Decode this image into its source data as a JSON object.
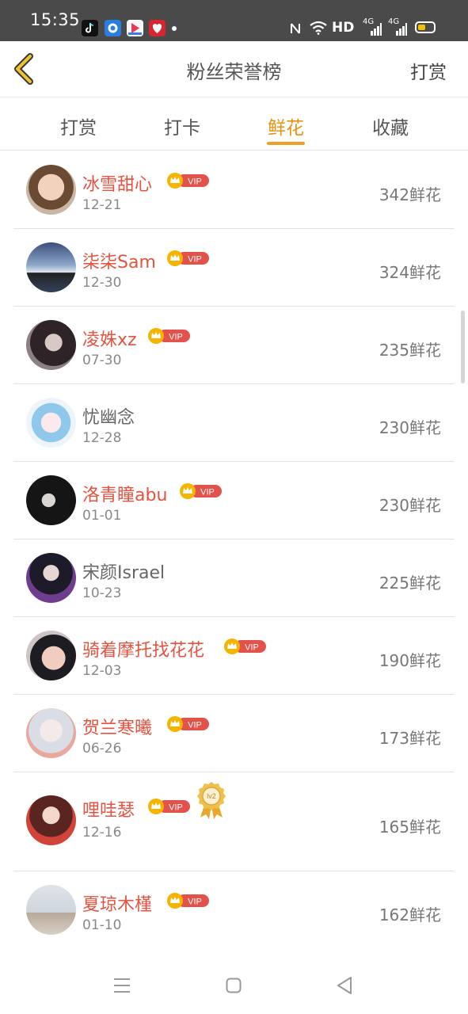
{
  "status_bar": {
    "time": "15:35",
    "network_label": "HD",
    "signal1": "4G",
    "signal2": "4G",
    "apps": [
      {
        "icon": "tiktok-icon",
        "color": "#111111"
      },
      {
        "icon": "browser-icon",
        "color": "#2a7de1"
      },
      {
        "icon": "video-app-icon",
        "color": "#e33b5a"
      },
      {
        "icon": "heart-app-icon",
        "color": "#d8262e"
      }
    ]
  },
  "header": {
    "title": "粉丝荣誉榜",
    "action": "打赏"
  },
  "tabs": [
    {
      "label": "打赏",
      "active": false
    },
    {
      "label": "打卡",
      "active": false
    },
    {
      "label": "鲜花",
      "active": true
    },
    {
      "label": "收藏",
      "active": false
    }
  ],
  "vip_text": "VIP",
  "level_badge_text": "lv2",
  "fans": [
    {
      "name": "冰雪甜心",
      "date": "12-21",
      "count": "342鲜花",
      "vip": true
    },
    {
      "name": "柒柒Sam",
      "date": "12-30",
      "count": "324鲜花",
      "vip": true
    },
    {
      "name": "凌姝xz",
      "date": "07-30",
      "count": "235鲜花",
      "vip": true
    },
    {
      "name": "忧幽念",
      "date": "12-28",
      "count": "230鲜花",
      "vip": false
    },
    {
      "name": "洛青瞳abu",
      "date": "01-01",
      "count": "230鲜花",
      "vip": true
    },
    {
      "name": "宋颜Israel",
      "date": "10-23",
      "count": "225鲜花",
      "vip": false
    },
    {
      "name": "骑着摩托找花花",
      "date": "12-03",
      "count": "190鲜花",
      "vip": true
    },
    {
      "name": "贺兰寒曦",
      "date": "06-26",
      "count": "173鲜花",
      "vip": true
    },
    {
      "name": "哩哇瑟",
      "date": "12-16",
      "count": "165鲜花",
      "vip": true,
      "level": true
    },
    {
      "name": "夏琼木槿",
      "date": "01-10",
      "count": "162鲜花",
      "vip": true
    }
  ],
  "colors": {
    "accent": "#f0a020",
    "vip_name": "#e3533f",
    "status_bar": "#4a4a4a"
  }
}
